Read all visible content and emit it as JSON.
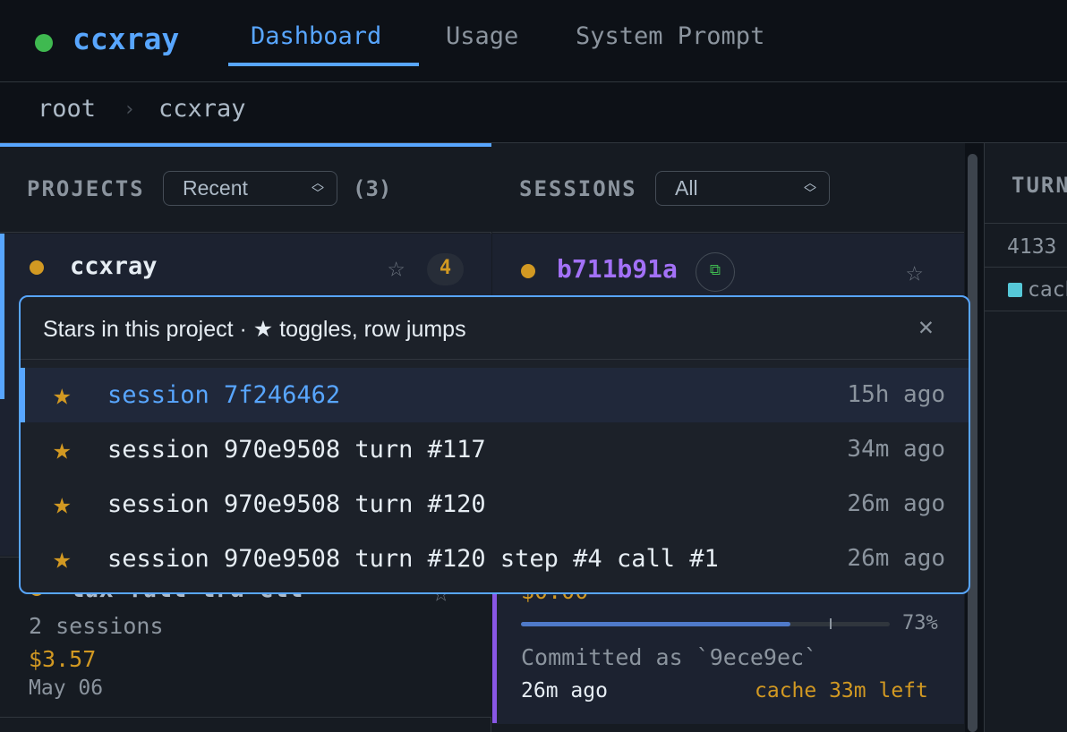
{
  "app": {
    "name": "ccxray",
    "status_color": "#3fb950"
  },
  "nav": {
    "tabs": [
      "Dashboard",
      "Usage",
      "System Prompt"
    ],
    "active": "Dashboard"
  },
  "breadcrumb": [
    "root",
    "ccxray"
  ],
  "projects": {
    "title": "PROJECTS",
    "filter": "Recent",
    "count": "(3)",
    "items": [
      {
        "name": "ccxray",
        "star_count": "4"
      },
      {
        "name": "lux-full-trd-ctl",
        "sessions": "2 sessions",
        "cost": "$3.57",
        "date": "May 06"
      }
    ]
  },
  "sessions": {
    "title": "SESSIONS",
    "filter": "All",
    "card": {
      "id": "b711b91a",
      "cost_partial": "$0.00",
      "progress": 0.73,
      "progress_label": "73%",
      "commit": "Committed as `9ece9ec`",
      "time": "26m ago",
      "cache": "cache 33m left"
    }
  },
  "turns": {
    "title": "TURN",
    "value": "4133",
    "legend": "cach",
    "legend_color": "#56c8d8"
  },
  "popover": {
    "title": "Stars in this project · ★ toggles, row jumps",
    "close": "✕",
    "items": [
      {
        "label": "session 7f246462",
        "time": "15h ago"
      },
      {
        "label": "session 970e9508 turn #117",
        "time": "34m ago"
      },
      {
        "label": "session 970e9508 turn #120",
        "time": "26m ago"
      },
      {
        "label": "session 970e9508 turn #120 step #4 call #1",
        "time": "26m ago"
      }
    ]
  },
  "colors": {
    "accent": "#58a6ff",
    "star": "#d29922",
    "session_id": "#a371f7",
    "cost": "#d29922"
  }
}
